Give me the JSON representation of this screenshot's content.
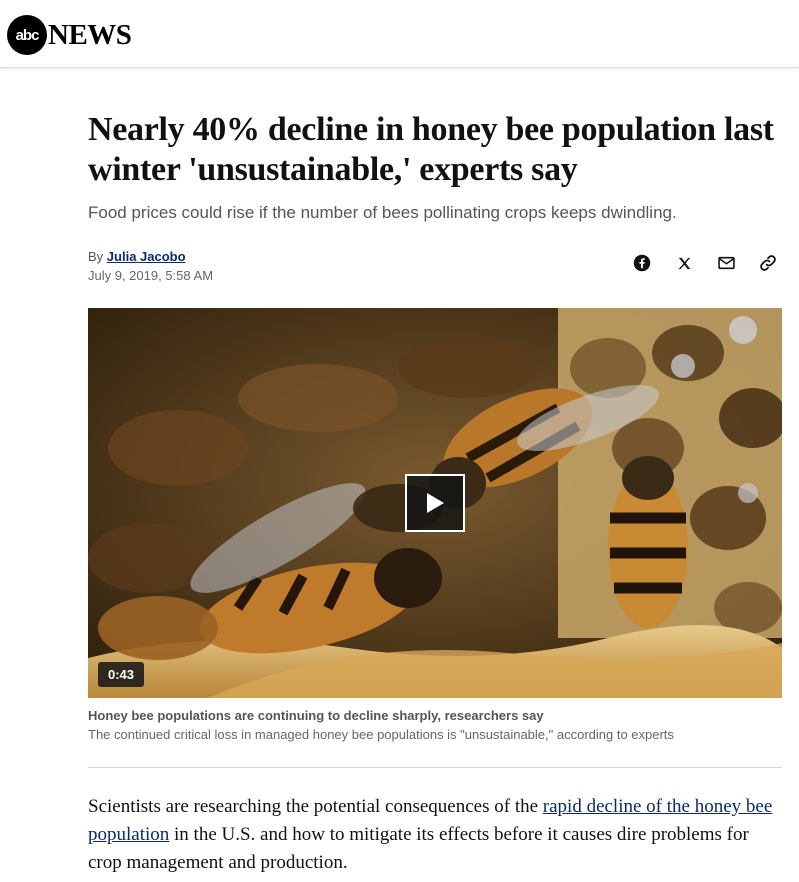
{
  "site": {
    "logo_mark": "abc",
    "logo_word": "NEWS"
  },
  "article": {
    "headline": "Nearly 40% decline in honey bee population last winter 'unsustainable,' experts say",
    "subhead": "Food prices could rise if the number of bees pollinating crops keeps dwindling.",
    "byline_prefix": "By",
    "author": "Julia Jacobo",
    "date": "July 9, 2019, 5:58 AM",
    "body_before_link": "Scientists are researching the potential consequences of the ",
    "body_link": "rapid decline of the honey bee population",
    "body_after_link": " in the U.S. and how to mitigate its effects before it causes dire problems for crop management and production."
  },
  "share": {
    "icons": [
      "facebook-icon",
      "x-icon",
      "email-icon",
      "link-icon"
    ]
  },
  "video": {
    "duration": "0:43",
    "caption_title": "Honey bee populations are continuing to decline sharply, researchers say",
    "caption_text": "The continued critical loss in managed honey bee populations is \"unsustainable,\" according to experts"
  },
  "colors": {
    "link": "#0b2a6b",
    "headline": "#111111",
    "muted": "#555555"
  }
}
